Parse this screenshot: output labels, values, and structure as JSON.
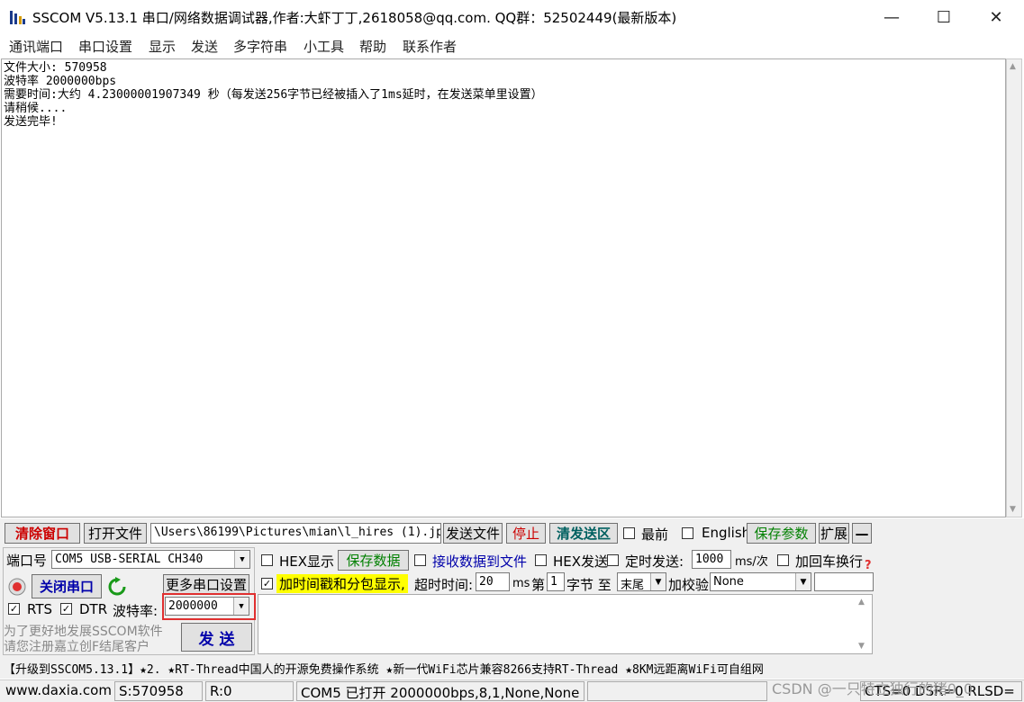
{
  "window": {
    "title": "SSCOM V5.13.1 串口/网络数据调试器,作者:大虾丁丁,2618058@qq.com. QQ群：52502449(最新版本)",
    "minimize": "—",
    "maximize": "☐",
    "close": "✕"
  },
  "menu": [
    "通讯端口",
    "串口设置",
    "显示",
    "发送",
    "多字符串",
    "小工具",
    "帮助",
    "联系作者"
  ],
  "output_lines": [
    "文件大小: 570958",
    "波特率 2000000bps",
    "需要时间:大约 4.23000001907349 秒（每发送256字节已经被插入了1ms延时，在发送菜单里设置）",
    "请稍候....",
    "发送完毕!"
  ],
  "toolbar": {
    "clear_window": "清除窗口",
    "open_file": "打开文件",
    "file_path": "\\Users\\86199\\Pictures\\mian\\l_hires (1).jpg",
    "send_file": "发送文件",
    "stop": "停止",
    "clear_send": "清发送区",
    "topmost": "最前",
    "english": "English",
    "save_params": "保存参数",
    "expand": "扩展",
    "collapse": "—"
  },
  "port": {
    "port_label": "端口号",
    "port_value": "COM5 USB-SERIAL CH340",
    "close_port": "关闭串口",
    "more_settings": "更多串口设置",
    "rts": "RTS",
    "dtr": "DTR",
    "baud_label": "波特率:",
    "baud_value": "2000000",
    "promo_line1": "为了更好地发展SSCOM软件",
    "promo_line2": "请您注册嘉立创F结尾客户",
    "send": "发 送"
  },
  "options": {
    "hex_display": "HEX显示",
    "save_data": "保存数据",
    "recv_to_file": "接收数据到文件",
    "hex_send": "HEX发送",
    "timed_send": "定时发送:",
    "timed_value": "1000",
    "timed_unit": "ms/次",
    "add_crlf": "加回车换行",
    "timestamp": "加时间戳和分包显示,",
    "timeout_label": "超时时间:",
    "timeout_value": "20",
    "timeout_unit": "ms",
    "byte_label_1": "第",
    "byte_value": "1",
    "byte_label_2": "字节 至",
    "byte_end": "末尾",
    "checksum_label": "加校验",
    "checksum_value": "None",
    "help": "?"
  },
  "ticker": "【升级到SSCOM5.13.1】★2. ★RT-Thread中国人的开源免费操作系统 ★新一代WiFi芯片兼容8266支持RT-Thread ★8KM远距离WiFi可自组网",
  "status": {
    "website": "www.daxia.com",
    "sent": "S:570958",
    "received": "R:0",
    "port_info": "COM5 已打开  2000000bps,8,1,None,None",
    "signals": "CTS=0 DSR=0 RLSD=",
    "watermark": "CSDN @一只特立独行的猪0_0"
  },
  "colors": {
    "accent_red": "#e03030",
    "timestamp_bg": "#ffff00"
  }
}
